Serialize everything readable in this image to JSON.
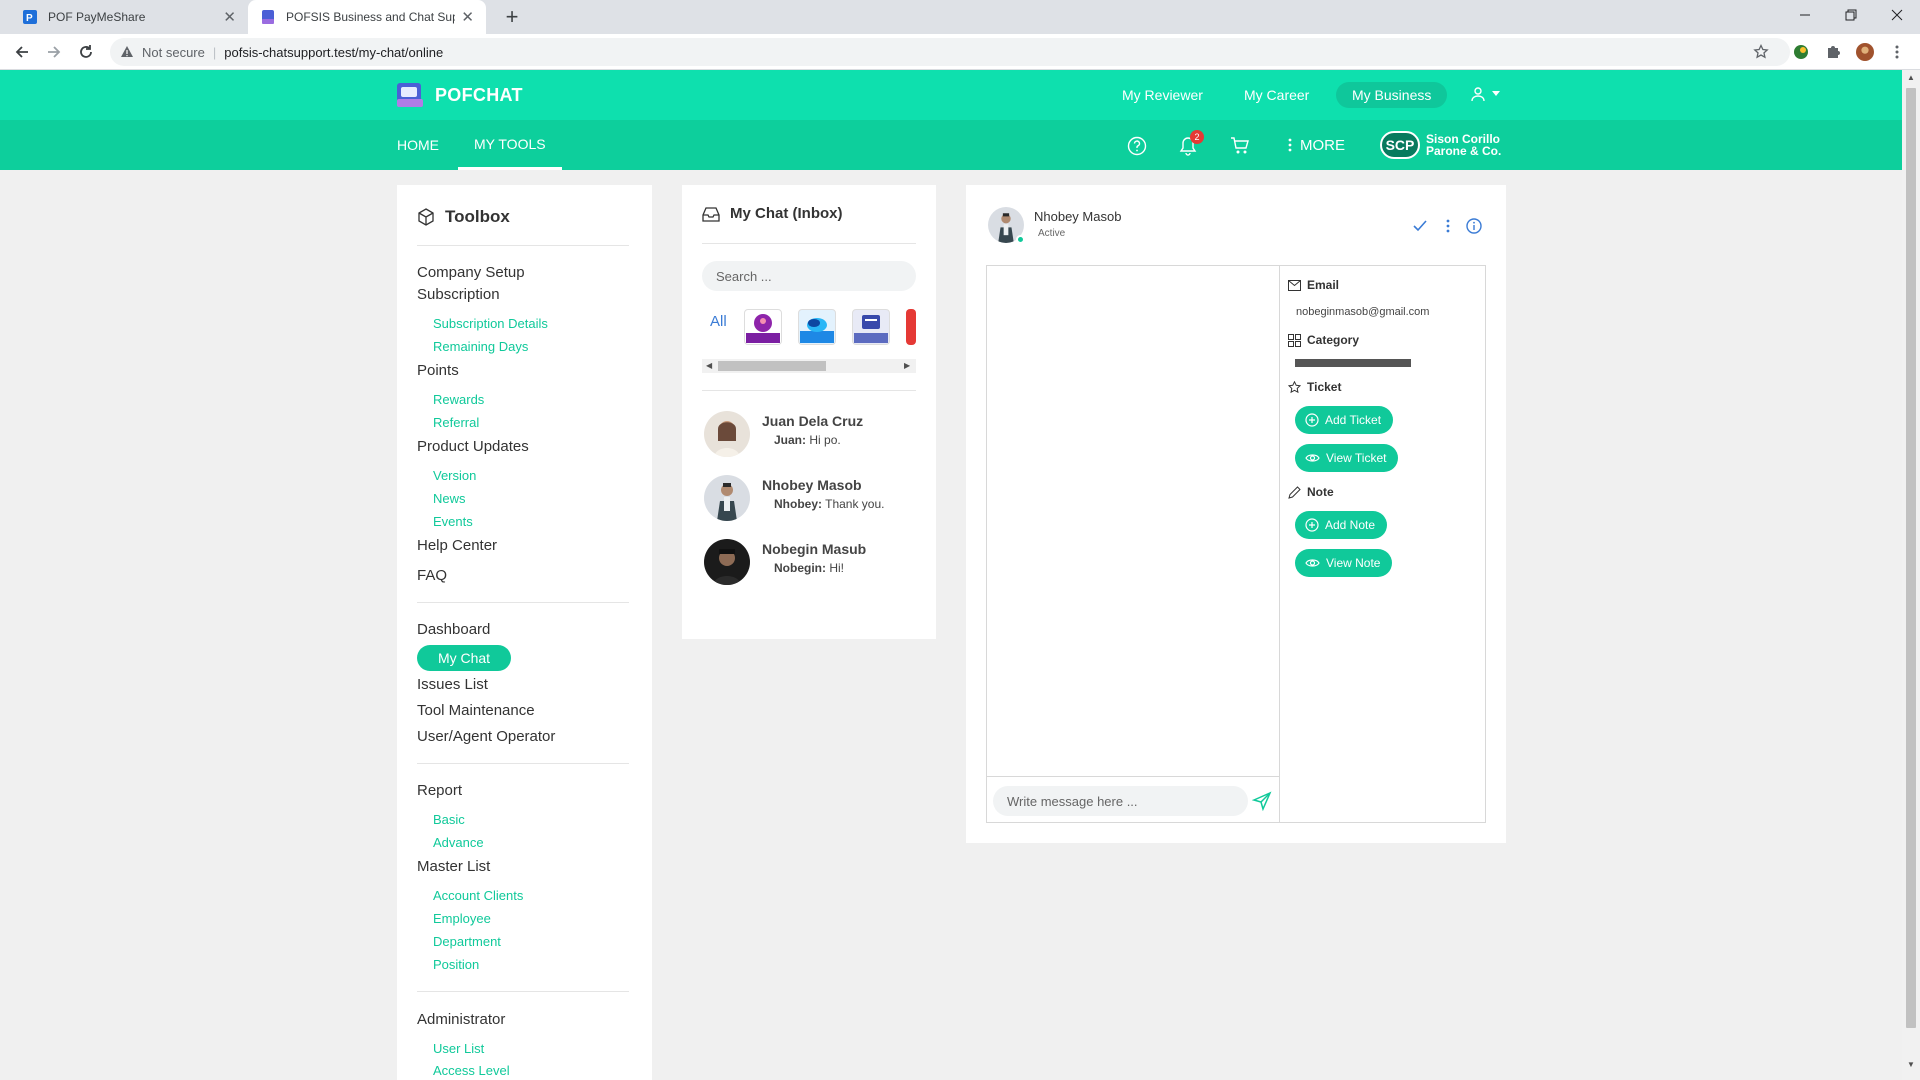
{
  "browser": {
    "tabs": [
      {
        "label": "POF PayMeShare"
      },
      {
        "label": "POFSIS Business and Chat Support"
      }
    ],
    "not_secure": "Not secure",
    "url": "pofsis-chatsupport.test/my-chat/online"
  },
  "header": {
    "logo_text": "POFCHAT",
    "nav": [
      {
        "label": "My Reviewer"
      },
      {
        "label": "My Career"
      },
      {
        "label": "My Business"
      }
    ]
  },
  "subheader": {
    "tabs": [
      {
        "label": "HOME"
      },
      {
        "label": "MY TOOLS"
      }
    ],
    "notif_count": "2",
    "more_label": "MORE",
    "company_initials": "SCP",
    "company_line1": "Sison Corillo",
    "company_line2": "Parone & Co."
  },
  "toolbox": {
    "title": "Toolbox",
    "company_setup": "Company Setup",
    "subscription": "Subscription",
    "subscription_details": "Subscription Details",
    "remaining_days": "Remaining Days",
    "points": "Points",
    "rewards": "Rewards",
    "referral": "Referral",
    "product_updates": "Product Updates",
    "version": "Version",
    "news": "News",
    "events": "Events",
    "help_center": "Help Center",
    "faq": "FAQ",
    "dashboard": "Dashboard",
    "my_chat": "My Chat",
    "issues_list": "Issues List",
    "tool_maintenance": "Tool Maintenance",
    "user_agent_operator": "User/Agent Operator",
    "report": "Report",
    "basic": "Basic",
    "advance": "Advance",
    "master_list": "Master List",
    "account_clients": "Account Clients",
    "employee": "Employee",
    "department": "Department",
    "position": "Position",
    "administrator": "Administrator",
    "user_list": "User List",
    "access_level": "Access Level"
  },
  "inbox": {
    "title": "My Chat (Inbox)",
    "search_placeholder": "Search ...",
    "filter_all": "All",
    "conversations": [
      {
        "name": "Juan Dela Cruz",
        "sender": "Juan:",
        "message": "Hi po."
      },
      {
        "name": "Nhobey Masob",
        "sender": "Nhobey:",
        "message": "Thank you."
      },
      {
        "name": "Nobegin Masub",
        "sender": "Nobegin:",
        "message": "Hi!"
      }
    ]
  },
  "chat": {
    "contact_name": "Nhobey Masob",
    "contact_status": "Active",
    "message_placeholder": "Write message here ...",
    "info": {
      "email_label": "Email",
      "email_value": "nobeginmasob@gmail.com",
      "category_label": "Category",
      "ticket_label": "Ticket",
      "add_ticket": "Add Ticket",
      "view_ticket": "View Ticket",
      "note_label": "Note",
      "add_note": "Add Note",
      "view_note": "View Note"
    }
  },
  "colors": {
    "header": "#0ee0ae",
    "subheader": "#0dcf9c",
    "accent": "#10c99a"
  }
}
